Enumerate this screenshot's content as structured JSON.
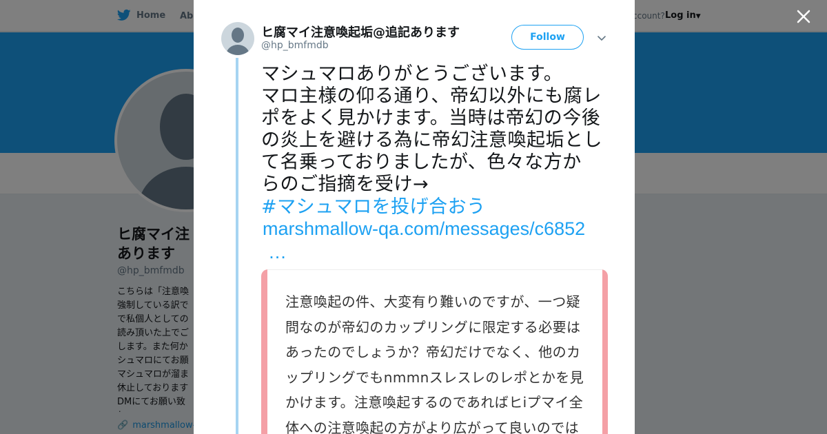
{
  "background": {
    "nav": {
      "home_label": "Home",
      "about_label": "Abo",
      "account_prompt": "ccount?",
      "login_label": "Log in"
    },
    "profile": {
      "name_lines": [
        "ヒ腐マイ注",
        "あります"
      ],
      "handle": "@hp_bmfmdb",
      "bio_lines": [
        "こちらは「注意喚",
        "強制している訳で",
        "で私個人としての",
        "読み頂いた上でご",
        "します。また何か",
        "シュマロにてお願",
        "マシュマロが溜ま",
        "休止しております",
        "DMにてお願い致し"
      ],
      "link": "marshmallow-"
    }
  },
  "modal": {
    "display_name": "ヒ腐マイ注意喚起垢@追記あります",
    "handle": "@hp_bmfmdb",
    "follow_label": "Follow",
    "tweet_lines": [
      "マシュマロありがとうございます。",
      "マロ主様の仰る通り、帝幻以外にも腐レ",
      "ポをよく見かけます。当時は帝幻の今後",
      "の炎上を避ける為に帝幻注意喚起垢とし",
      "て名乗っておりましたが、色々な方か",
      "らのご指摘を受け→"
    ],
    "hashtag": "#マシュマロを投げ合おう",
    "link": "marshmallow-qa.com/messages/c6852",
    "link_ellipsis": "…",
    "card_lines": [
      "注意喚起の件、大変有り難いのですが、一つ疑",
      "問なのが帝幻のカップリングに限定する必要は",
      "あったのでしょうか？帝幻だけでなく、他のカ",
      "ップリングでもnmmnスレスレのレポとかを見",
      "かけます。注意喚起するのであればヒiプマイ全",
      "体への注意喚起の方がより広がって良いのでは"
    ]
  },
  "colors": {
    "brand_blue": "#1da1f2",
    "card_border_pink": "#f4a0a6",
    "thread_line": "#a6d4f2"
  }
}
